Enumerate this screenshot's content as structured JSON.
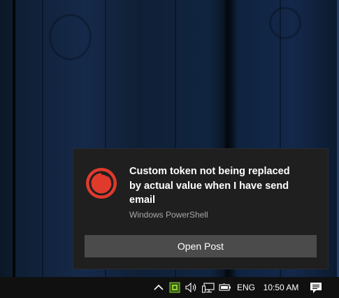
{
  "notification": {
    "title": "Custom token not being replaced by actual value when I have send email",
    "source": "Windows PowerShell",
    "action_label": "Open Post",
    "app_icon": "sitecore-logo",
    "app_icon_color": "#e03a2c"
  },
  "taskbar": {
    "language": "ENG",
    "time": "10:50 AM",
    "icons": [
      "chevron-up-icon",
      "app-tray-icon",
      "volume-icon",
      "network-icon",
      "battery-icon",
      "action-center-icon"
    ]
  },
  "colors": {
    "toast_background": "#1f1f1f",
    "button_background": "#4b4b4b",
    "taskbar_background": "#101010"
  }
}
